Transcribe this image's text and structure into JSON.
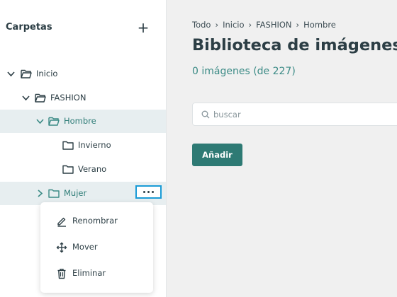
{
  "sidebar": {
    "title": "Carpetas",
    "add_icon": "plus-icon",
    "tree": [
      {
        "label": "Inicio",
        "icon": "folder-open-icon",
        "expanded": true
      },
      {
        "label": "FASHION",
        "icon": "folder-open-icon",
        "expanded": true
      },
      {
        "label": "Hombre",
        "icon": "folder-open-icon",
        "expanded": true,
        "selected": true
      },
      {
        "label": "Invierno",
        "icon": "folder-icon"
      },
      {
        "label": "Verano",
        "icon": "folder-icon"
      },
      {
        "label": "Mujer",
        "icon": "folder-icon",
        "expanded": false,
        "hovered": true
      }
    ],
    "more_icon": "more-horizontal-icon"
  },
  "context_menu": {
    "items": [
      {
        "label": "Renombrar",
        "icon": "pencil-icon"
      },
      {
        "label": "Mover",
        "icon": "move-icon"
      },
      {
        "label": "Eliminar",
        "icon": "trash-icon"
      }
    ]
  },
  "main": {
    "breadcrumb": [
      "Todo",
      "Inicio",
      "FASHION",
      "Hombre"
    ],
    "title": "Biblioteca de imágenes",
    "count": "0 imágenes (de 227)",
    "search": {
      "placeholder": "buscar",
      "value": ""
    },
    "add_button": "Añadir"
  },
  "colors": {
    "accent": "#2e7a74",
    "accent_text": "#3a8a85",
    "selected_bg": "#e7eef0",
    "focus_outline": "#1a9bd6",
    "text": "#2c3e45"
  }
}
